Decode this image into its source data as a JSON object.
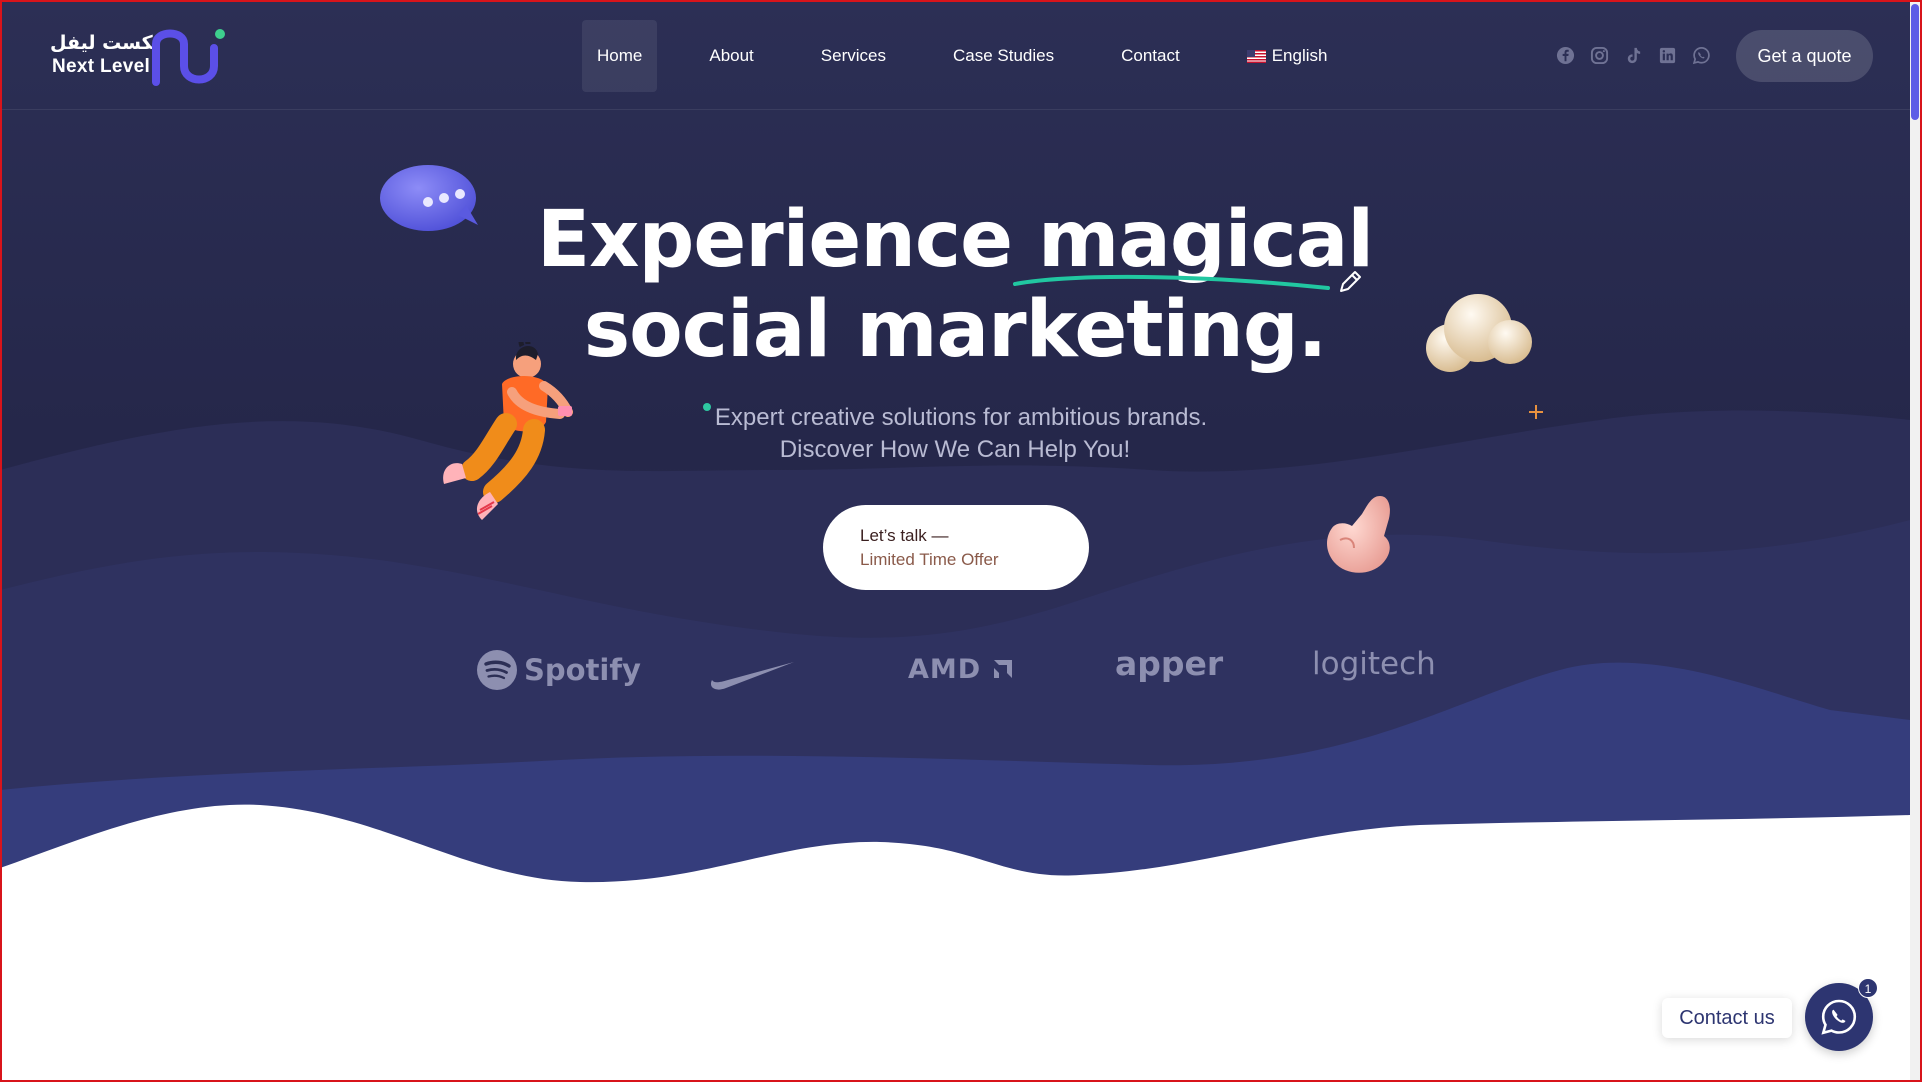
{
  "brand": {
    "arabic_name": "نكست ليفل",
    "name": "Next Level"
  },
  "nav": {
    "items": [
      {
        "label": "Home",
        "active": true
      },
      {
        "label": "About",
        "active": false
      },
      {
        "label": "Services",
        "active": false
      },
      {
        "label": "Case Studies",
        "active": false
      },
      {
        "label": "Contact",
        "active": false
      }
    ],
    "language": {
      "label": "English",
      "icon": "us-flag-icon"
    }
  },
  "socials": [
    "facebook-icon",
    "instagram-icon",
    "tiktok-icon",
    "linkedin-icon",
    "whatsapp-icon"
  ],
  "header_cta": {
    "label": "Get a quote"
  },
  "hero": {
    "headline_part1": "Experience",
    "headline_highlight": "magical",
    "headline_line2": "social marketing.",
    "subtitle_line1": "Expert creative solutions for ambitious brands.",
    "subtitle_line2": "Discover How We Can Help You!",
    "cta_title": "Let’s talk —",
    "cta_subtitle": "Limited Time Offer"
  },
  "brands": {
    "spotify": "Spotify",
    "nike": "nike-swoosh-logo",
    "amd": "AMD",
    "apper": "apper",
    "logitech": "logitech"
  },
  "contact_widget": {
    "label": "Contact us",
    "badge": "1",
    "icon": "whatsapp-icon"
  },
  "colors": {
    "hero_bg": "#2a2c52",
    "wave_blue": "#353d7c",
    "accent_green": "#2ec7a1",
    "logo_purple": "#5b4fe8",
    "button_navy": "#2d3571"
  }
}
